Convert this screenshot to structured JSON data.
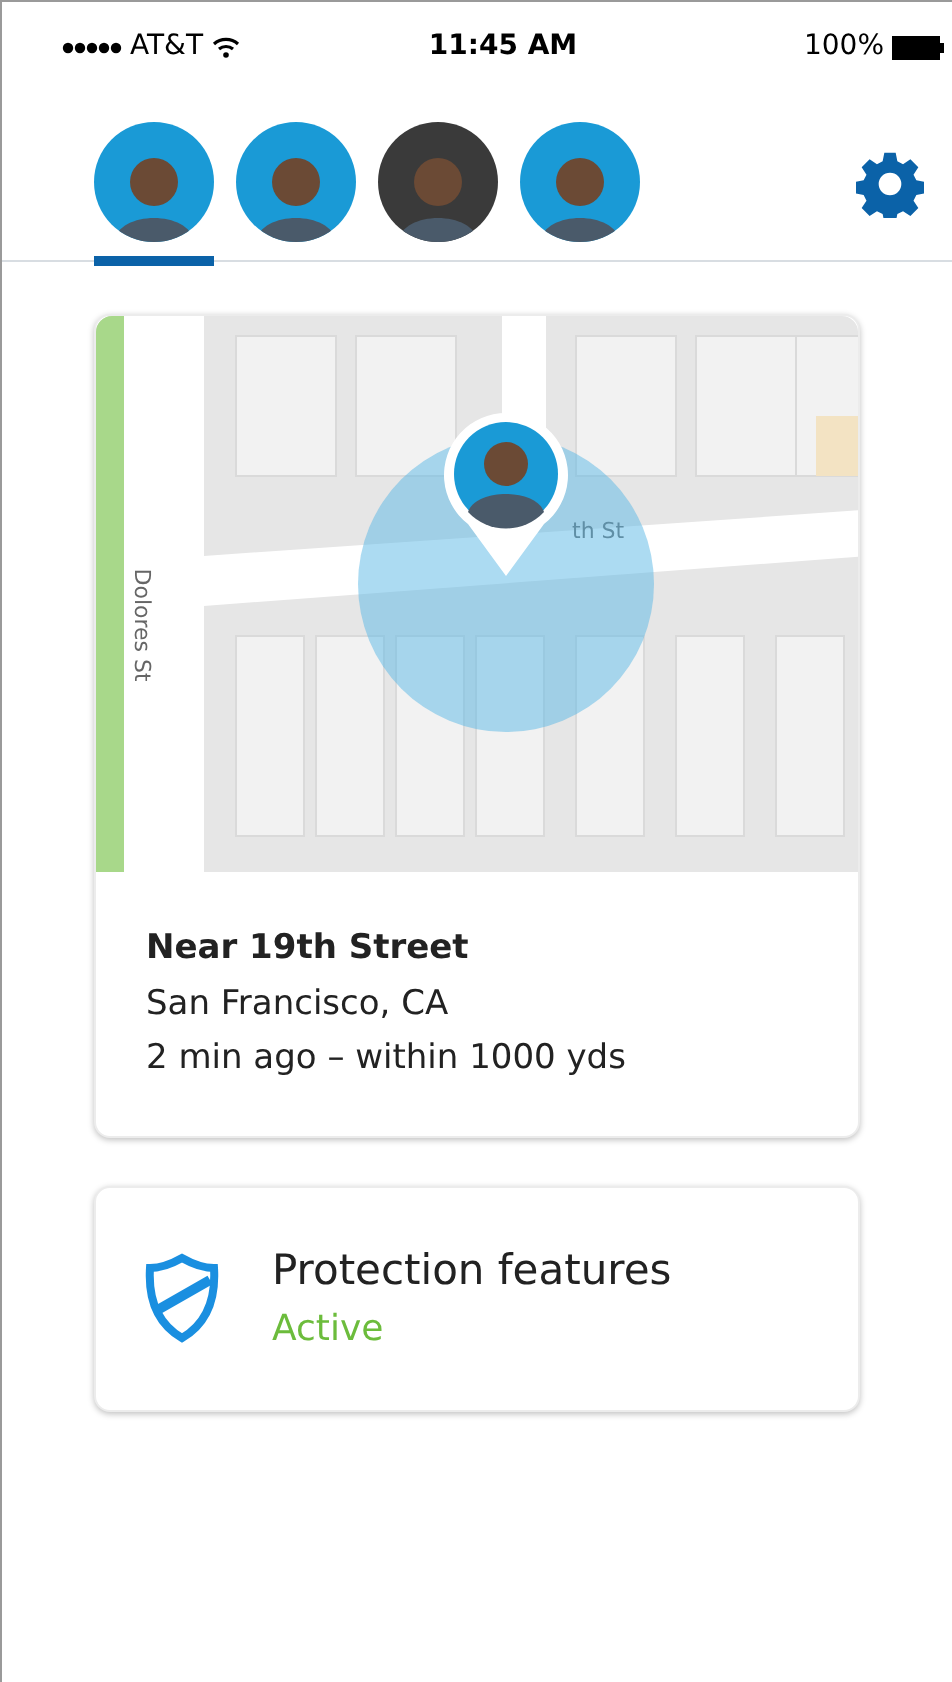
{
  "status_bar": {
    "carrier": "AT&T",
    "time": "11:45 AM",
    "battery": "100%"
  },
  "profiles": [
    {
      "selected": true,
      "color": "#1a9ad6"
    },
    {
      "selected": false,
      "color": "#1a9ad6"
    },
    {
      "selected": false,
      "color": "#3a3a3a"
    },
    {
      "selected": false,
      "color": "#1a9ad6"
    }
  ],
  "location_card": {
    "map_labels": [
      "Dolores St",
      "th St"
    ],
    "place": "Near 19th Street",
    "city": "San Francisco, CA",
    "detail": "2 min ago – within 1000 yds"
  },
  "protection_card": {
    "title": "Protection features",
    "status": "Active",
    "active": true
  }
}
